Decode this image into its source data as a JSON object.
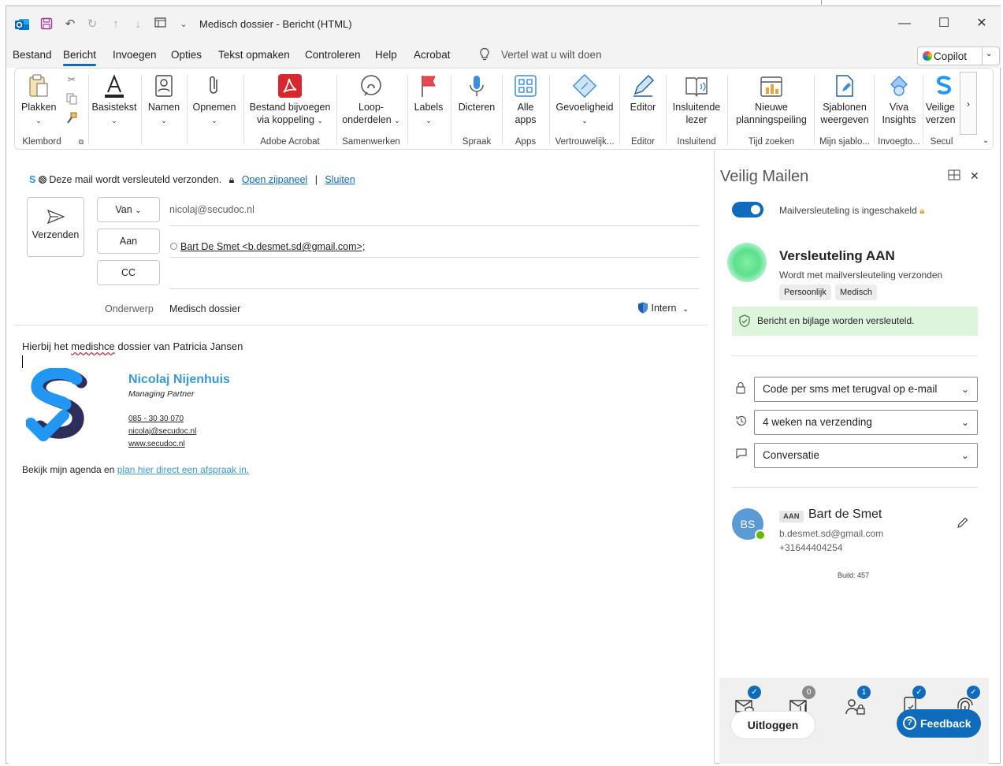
{
  "window": {
    "title": "Medisch dossier  -  Bericht (HTML)"
  },
  "menu": {
    "tabs": [
      "Bestand",
      "Bericht",
      "Invoegen",
      "Opties",
      "Tekst opmaken",
      "Controleren",
      "Help",
      "Acrobat"
    ],
    "active_tab": "Bericht",
    "tell_me": "Vertel wat u wilt doen",
    "copilot": "Copilot"
  },
  "ribbon": {
    "clipboard": {
      "paste": "Plakken",
      "group": "Klembord"
    },
    "basictext": {
      "label": "Basistekst"
    },
    "names": {
      "label": "Namen"
    },
    "include": {
      "label": "Opnemen"
    },
    "acrobat": {
      "label1": "Bestand bijvoegen",
      "label2": "via koppeling",
      "group": "Adobe Acrobat"
    },
    "loop": {
      "label1": "Loop-",
      "label2": "onderdelen",
      "group": "Samenwerken"
    },
    "labels": {
      "label": "Labels"
    },
    "dictate": {
      "label": "Dicteren",
      "group": "Spraak"
    },
    "allapps": {
      "label1": "Alle",
      "label2": "apps",
      "group": "Apps"
    },
    "sensitivity": {
      "label": "Gevoeligheid",
      "group": "Vertrouwelijk..."
    },
    "editor": {
      "label": "Editor",
      "group": "Editor"
    },
    "reader": {
      "label1": "Insluitende",
      "label2": "lezer",
      "group": "Insluitend"
    },
    "poll": {
      "label1": "Nieuwe",
      "label2": "planningspeiling",
      "group": "Tijd zoeken"
    },
    "templates": {
      "label1": "Sjablonen",
      "label2": "weergeven",
      "group": "Mijn sjablo..."
    },
    "viva": {
      "label1": "Viva",
      "label2": "Insights",
      "group": "Invoegto..."
    },
    "secure": {
      "label1": "Veilige",
      "label2": "verzen",
      "group": "Secul"
    }
  },
  "compose": {
    "banner_text": "Deze mail wordt versleuteld verzonden.",
    "banner_open": "Open zijpaneel",
    "banner_sep": "|",
    "banner_close": "Sluiten",
    "send": "Verzenden",
    "from_btn": "Van",
    "from_value": "nicolaj@secudoc.nl",
    "to_btn": "Aan",
    "to_value": "Bart De Smet <b.desmet.sd@gmail.com>;",
    "cc_btn": "CC",
    "subject_label": "Onderwerp",
    "subject_value": "Medisch dossier",
    "intern": "Intern",
    "body_pre": "Hierbij het ",
    "body_misspelled": "medishce",
    "body_post": " dossier van Patricia Jansen",
    "sig_name": "Nicolaj Nijenhuis",
    "sig_role": "Managing Partner",
    "sig_phone": "085 - 30 30 070",
    "sig_email": "nicolaj@secudoc.nl",
    "sig_web": "www.secudoc.nl",
    "agenda_text": "Bekijk mijn agenda en ",
    "agenda_link": "plan hier direct een afspraak in."
  },
  "panel": {
    "title": "Veilig Mailen",
    "toggle_label": "Mailversleuteling is ingeschakeld",
    "status_title": "Versleuteling AAN",
    "status_sub": "Wordt met mailversleuteling verzonden",
    "tags": [
      "Persoonlijk",
      "Medisch"
    ],
    "info": "Bericht en bijlage worden versleuteld.",
    "auth_method": "Code per sms met terugval op e-mail",
    "expiry": "4 weken na verzending",
    "reply": "Conversatie",
    "recipient": {
      "initials": "BS",
      "badge": "AAN",
      "name": "Bart de Smet",
      "email": "b.desmet.sd@gmail.com",
      "phone": "+31644404254"
    },
    "build": "Build: 457",
    "badges": [
      "",
      "0",
      "1",
      "",
      ""
    ],
    "logout": "Uitloggen",
    "feedback": "Feedback"
  }
}
